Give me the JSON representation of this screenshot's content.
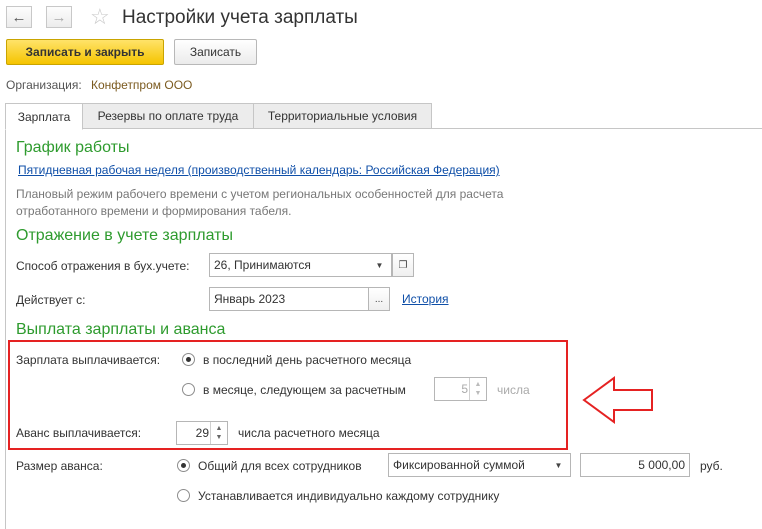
{
  "window": {
    "title": "Настройки учета зарплаты",
    "back_icon": "arrow-left-icon",
    "forward_icon": "arrow-right-icon",
    "favorite_icon": "star-icon"
  },
  "toolbar": {
    "save_close_label": "Записать и закрыть",
    "save_label": "Записать"
  },
  "organization": {
    "label": "Организация:",
    "value": "Конфетпром ООО"
  },
  "tabs": [
    {
      "label": "Зарплата",
      "active": true
    },
    {
      "label": "Резервы по оплате труда",
      "active": false
    },
    {
      "label": "Территориальные условия",
      "active": false
    }
  ],
  "schedule": {
    "heading": "График работы",
    "link": "Пятидневная рабочая неделя (производственный календарь: Российская Федерация)",
    "note_line1": "Плановый режим рабочего времени с учетом региональных особенностей для расчета",
    "note_line2": "отработанного времени и формирования табеля."
  },
  "accounting": {
    "heading": "Отражение в учете зарплаты",
    "method_label": "Способ отражения в бух.учете:",
    "method_value": "26, Принимаются",
    "effective_label": "Действует с:",
    "effective_value": "Январь 2023",
    "history_link": "История"
  },
  "payment": {
    "heading": "Выплата зарплаты и аванса",
    "salary_label": "Зарплата выплачивается:",
    "option_last_day": "в последний день расчетного месяца",
    "option_next_month": "в месяце, следующем за расчетным",
    "next_month_day": "5",
    "day_suffix": "числа",
    "advance_label": "Аванс выплачивается:",
    "advance_day": "29",
    "advance_suffix": "числа расчетного месяца",
    "advance_size_label": "Размер аванса:",
    "option_common": "Общий для всех сотрудников",
    "advance_method": "Фиксированной суммой",
    "advance_amount": "5 000,00",
    "currency": "руб.",
    "option_individual": "Устанавливается индивидуально каждому сотруднику"
  },
  "colors": {
    "section_heading": "#2e9b2e",
    "link": "#0f4fa8",
    "primary_button": "#f5c400",
    "annotation": "#e52222"
  }
}
